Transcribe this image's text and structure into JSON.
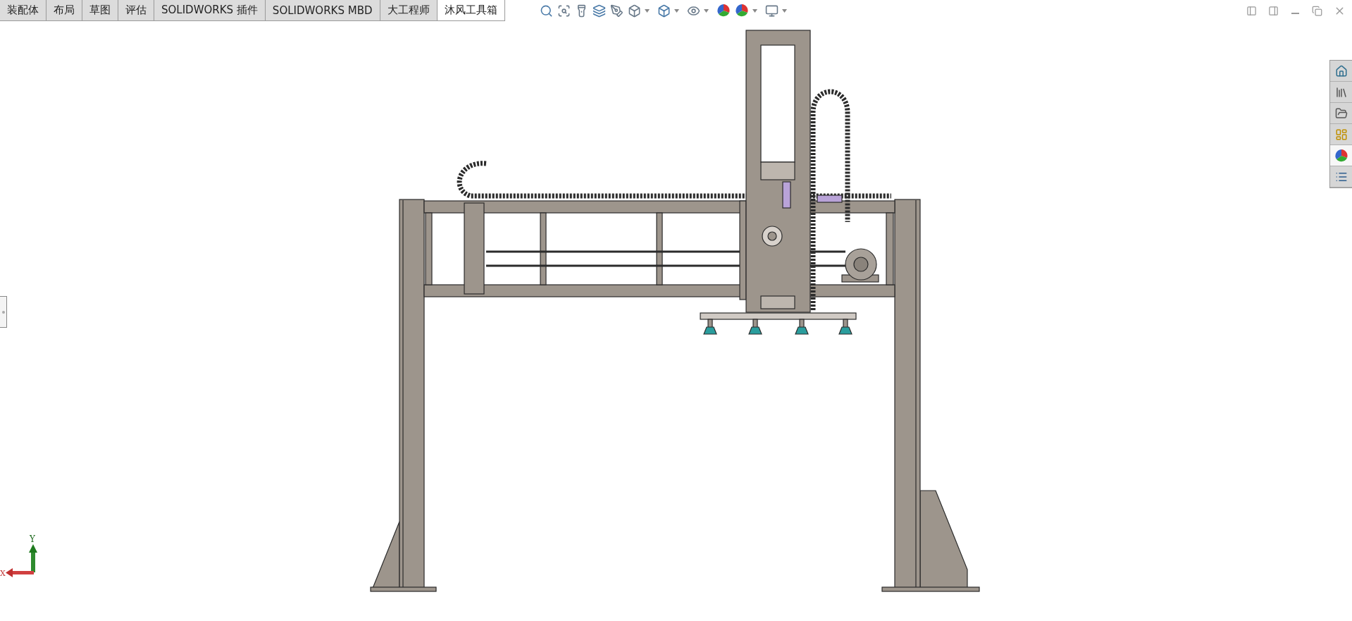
{
  "tabs": [
    {
      "label": "装配体",
      "selected": false
    },
    {
      "label": "布局",
      "selected": false
    },
    {
      "label": "草图",
      "selected": false
    },
    {
      "label": "评估",
      "selected": false
    },
    {
      "label": "SOLIDWORKS 插件",
      "selected": false
    },
    {
      "label": "SOLIDWORKS MBD",
      "selected": false
    },
    {
      "label": "大工程师",
      "selected": false
    },
    {
      "label": "沐风工具箱",
      "selected": true
    }
  ],
  "task_pane": [
    {
      "kind": "home",
      "selected": false
    },
    {
      "kind": "library",
      "selected": false
    },
    {
      "kind": "folder",
      "selected": false
    },
    {
      "kind": "palette",
      "selected": false
    },
    {
      "kind": "appearance",
      "selected": true
    },
    {
      "kind": "properties",
      "selected": false
    }
  ],
  "triad": {
    "x_label": "X",
    "y_label": "Y"
  }
}
